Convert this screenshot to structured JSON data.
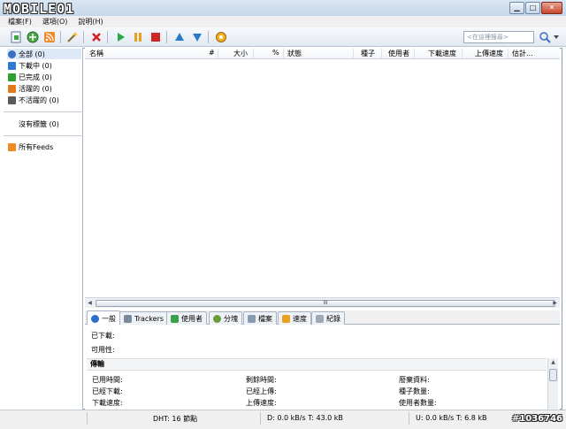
{
  "brand": "MOBILE01",
  "menu": {
    "items": [
      "檔案(F)",
      "選項(O)",
      "說明(H)"
    ]
  },
  "toolbar": {
    "search_placeholder": "<在這裡搜尋>",
    "buttons": [
      "add-torrent-icon",
      "add-url-icon",
      "rss-icon",
      "create-torrent-icon",
      "remove-icon",
      "start-icon",
      "pause-icon",
      "stop-icon",
      "move-up-icon",
      "move-down-icon",
      "preferences-icon",
      "search-engine-icon"
    ]
  },
  "sidebar": {
    "categories": [
      {
        "label": "全部 (0)",
        "color": "#3a6fc4"
      },
      {
        "label": "下載中 (0)",
        "color": "#2e7bd6"
      },
      {
        "label": "已完成 (0)",
        "color": "#2ea02e"
      },
      {
        "label": "活躍的 (0)",
        "color": "#e07b1a"
      },
      {
        "label": "不活躍的 (0)",
        "color": "#5a5a5a"
      }
    ],
    "labels_item": "沒有標籤 (0)",
    "feeds_item": "所有Feeds"
  },
  "list": {
    "columns": [
      "名稱",
      "#",
      "大小",
      "%",
      "狀態",
      "種子",
      "使用者",
      "下載速度",
      "上傳速度",
      "估計..."
    ],
    "scroll_handle": "III"
  },
  "details": {
    "tabs": [
      "一般",
      "Trackers",
      "使用者",
      "分塊",
      "檔案",
      "速度",
      "紀錄"
    ],
    "downloaded_label": "已下載:",
    "availability_label": "可用性:",
    "section_title": "傳輸",
    "fields": [
      [
        "已用時間:",
        "剩餘時間:",
        "廢棄資料:"
      ],
      [
        "已經下載:",
        "已經上傳:",
        "種子數量:"
      ],
      [
        "下載速度:",
        "上傳速度:",
        "使用者數量:"
      ]
    ]
  },
  "status": {
    "dht": "DHT: 16 節點",
    "download": "D: 0.0 kB/s T: 43.0 kB",
    "upload": "U: 0.0 kB/s T: 6.8 kB",
    "watermark": "#1036746"
  },
  "colors": {
    "accent": "#3a6fc4",
    "selection": "#dde9f7"
  }
}
